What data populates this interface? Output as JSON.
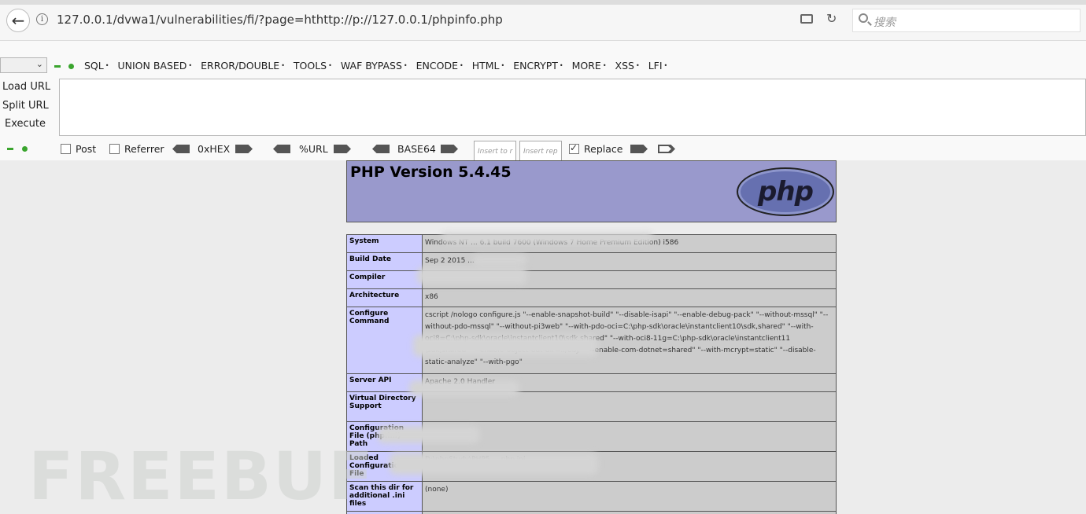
{
  "browser": {
    "url": "127.0.0.1/dvwa1/vulnerabilities/fi/?page=hthttp://p://127.0.0.1/phpinfo.php",
    "search_placeholder": "搜索"
  },
  "hackbar": {
    "menu": [
      "SQL",
      "UNION BASED",
      "ERROR/DOUBLE",
      "TOOLS",
      "WAF BYPASS",
      "ENCODE",
      "HTML",
      "ENCRYPT",
      "MORE",
      "XSS",
      "LFI"
    ],
    "load_url": "Load URL",
    "split_url": "Split URL",
    "execute": "Execute",
    "post": "Post",
    "referrer": "Referrer",
    "hex": "0xHEX",
    "url_enc": "%URL",
    "base64": "BASE64",
    "insert1_placeholder": "Insert to r",
    "insert2_placeholder": "Insert rep",
    "replace": "Replace",
    "post_checked": false,
    "referrer_checked": false,
    "replace_checked": true
  },
  "phpinfo": {
    "title": "PHP Version 5.4.45",
    "logo": "php",
    "rows": [
      {
        "key": "System",
        "value": "Windows NT ... 6.1 build 7600 (Windows 7 Home Premium Edition) i586"
      },
      {
        "key": "Build Date",
        "value": "Sep 2 2015 ..."
      },
      {
        "key": "Compiler",
        "value": ""
      },
      {
        "key": "Architecture",
        "value": "x86"
      },
      {
        "key": "Configure Command",
        "value": "cscript /nologo configure.js \"--enable-snapshot-build\" \"--disable-isapi\" \"--enable-debug-pack\" \"--without-mssql\" \"--without-pdo-mssql\" \"--without-pi3web\" \"--with-pdo-oci=C:\\php-sdk\\oracle\\instantclient10\\sdk,shared\" \"--with-oci8=C:\\php-sdk\\oracle\\instantclient10\\sdk,shared\" \"--with-oci8-11g=C:\\php-sdk\\oracle\\instantclient11 \\sdk,shared\" \"--enable-object-out-dir=../obj/\" \"--enable-com-dotnet=shared\" \"--with-mcrypt=static\" \"--disable-static-analyze\" \"--with-pgo\""
      },
      {
        "key": "Server API",
        "value": "Apache 2.0 Handler"
      },
      {
        "key": "Virtual Directory Support",
        "value": ""
      },
      {
        "key": "Configuration File (php.ini) Path",
        "value": ""
      },
      {
        "key": "Loaded Configuration File",
        "value": "D:\\phpStudy\\PHP5 ... php.ini"
      },
      {
        "key": "Scan this dir for additional .ini files",
        "value": "(none)"
      },
      {
        "key": "",
        "value": ""
      }
    ]
  },
  "watermark": "FREEBUF"
}
